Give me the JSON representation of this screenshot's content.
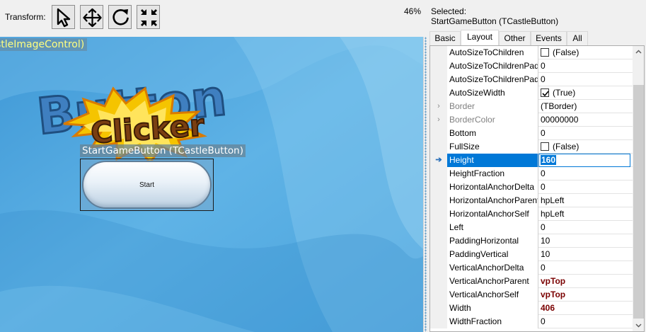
{
  "toolbar": {
    "transform_label": "Transform:",
    "tools": [
      {
        "name": "select-tool-button",
        "icon": "arrow-cursor-icon"
      },
      {
        "name": "move-tool-button",
        "icon": "move-arrows-icon"
      },
      {
        "name": "rotate-tool-button",
        "icon": "rotate-icon"
      },
      {
        "name": "resize-tool-button",
        "icon": "shrink-arrows-icon"
      }
    ],
    "zoom": "46%"
  },
  "canvas": {
    "image_control_label": "stleImageControl)",
    "logo_word_top": "Button",
    "logo_word_bottom": "Clicker",
    "button_label": "StartGameButton (TCastleButton)",
    "button_caption": "Start",
    "colors": {
      "background": "#4ea6dd",
      "logo_blue": "#3f7fc0",
      "logo_star": "#f5c400",
      "logo_text": "#7a3f12"
    }
  },
  "inspector": {
    "selected_caption": "Selected:",
    "selected_name": "StartGameButton (TCastleButton)",
    "tabs": [
      {
        "label": "Basic",
        "active": false
      },
      {
        "label": "Layout",
        "active": true
      },
      {
        "label": "Other",
        "active": false
      },
      {
        "label": "Events",
        "active": false
      },
      {
        "label": "All",
        "active": false
      }
    ],
    "properties": [
      {
        "name": "AutoSizeToChildren",
        "value": "(False)",
        "checkbox": "unchecked"
      },
      {
        "name": "AutoSizeToChildrenPadd",
        "value": "0"
      },
      {
        "name": "AutoSizeToChildrenPadd",
        "value": "0"
      },
      {
        "name": "AutoSizeWidth",
        "value": "(True)",
        "checkbox": "checked"
      },
      {
        "name": "Border",
        "value": "(TBorder)",
        "expandable": true,
        "muted": true
      },
      {
        "name": "BorderColor",
        "value": "00000000",
        "expandable": true,
        "muted": true
      },
      {
        "name": "Bottom",
        "value": "0"
      },
      {
        "name": "FullSize",
        "value": "(False)",
        "checkbox": "unchecked"
      },
      {
        "name": "Height",
        "value": "160",
        "selected": true
      },
      {
        "name": "HeightFraction",
        "value": "0"
      },
      {
        "name": "HorizontalAnchorDelta",
        "value": "0"
      },
      {
        "name": "HorizontalAnchorParent",
        "value": "hpLeft"
      },
      {
        "name": "HorizontalAnchorSelf",
        "value": "hpLeft"
      },
      {
        "name": "Left",
        "value": "0"
      },
      {
        "name": "PaddingHorizontal",
        "value": "10"
      },
      {
        "name": "PaddingVertical",
        "value": "10"
      },
      {
        "name": "VerticalAnchorDelta",
        "value": "0"
      },
      {
        "name": "VerticalAnchorParent",
        "value": "vpTop",
        "bold": true
      },
      {
        "name": "VerticalAnchorSelf",
        "value": "vpTop",
        "bold": true
      },
      {
        "name": "Width",
        "value": "406",
        "bold": true
      },
      {
        "name": "WidthFraction",
        "value": "0"
      }
    ],
    "colors": {
      "selection": "#0078d7",
      "modified_value": "#7a0000"
    }
  }
}
